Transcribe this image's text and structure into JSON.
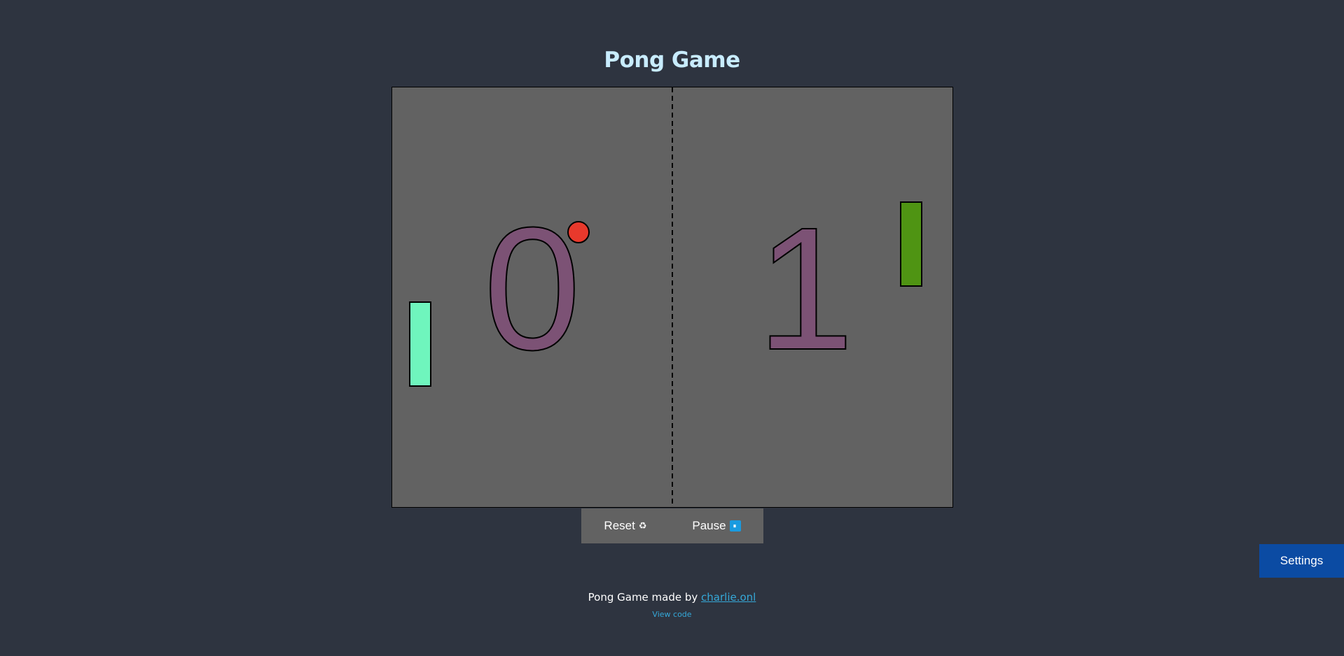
{
  "title": "Pong Game",
  "game": {
    "score_left": "0",
    "score_right": "1",
    "colors": {
      "field": "#626262",
      "score": "#7c5275",
      "left_paddle": "#6ff5bd",
      "right_paddle": "#4f9413",
      "ball": "#e8392c",
      "center_line": "#000000"
    }
  },
  "controls": {
    "reset_label": "Reset",
    "reset_icon": "♻",
    "pause_label": "Pause",
    "pause_icon": "⏸"
  },
  "settings_label": "Settings",
  "footer": {
    "prefix": "Pong Game made by ",
    "author_link": "charlie.onl",
    "view_code": "View code"
  }
}
